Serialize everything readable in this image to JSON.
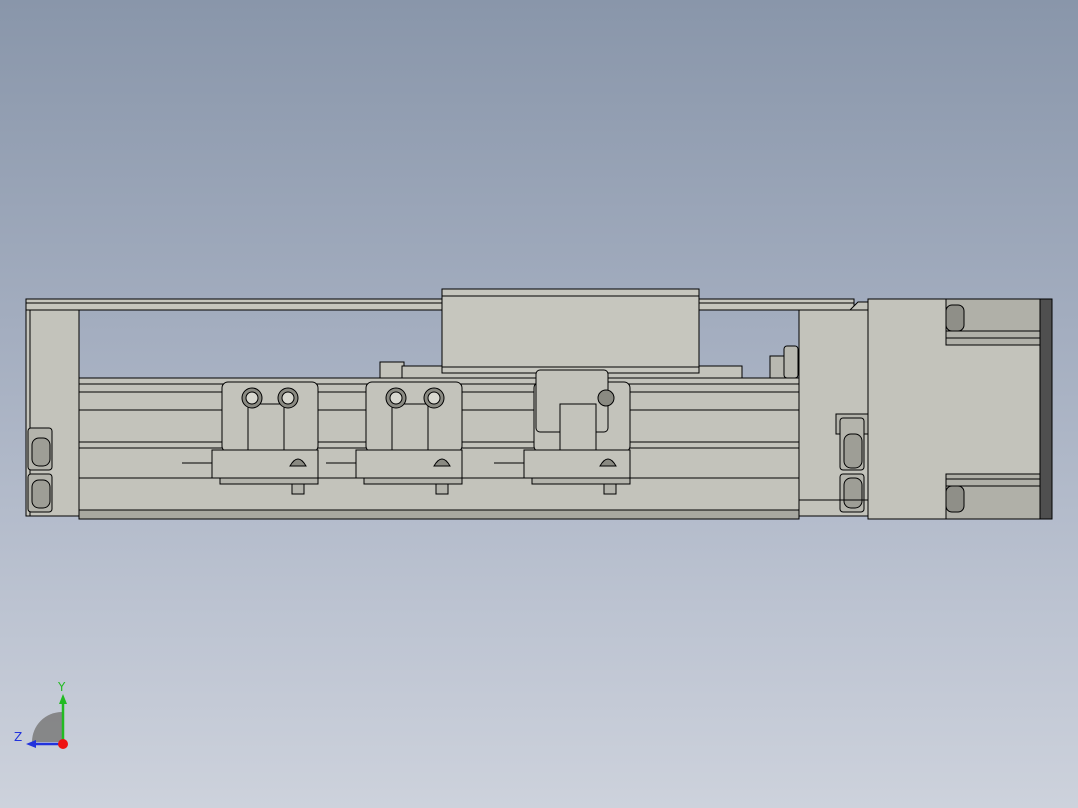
{
  "viewport": {
    "background_top": "#8996aa",
    "background_bottom": "#cdd2dc"
  },
  "model": {
    "part_color": "#c3c3bb",
    "shade_color": "#a9a9a1",
    "edge_color": "#000000",
    "clamp_count": 3
  },
  "triad": {
    "y_label": "Y",
    "z_label": "Z",
    "y_color": "#22bb22",
    "z_color": "#2233dd",
    "x_color": "#ee1111"
  }
}
